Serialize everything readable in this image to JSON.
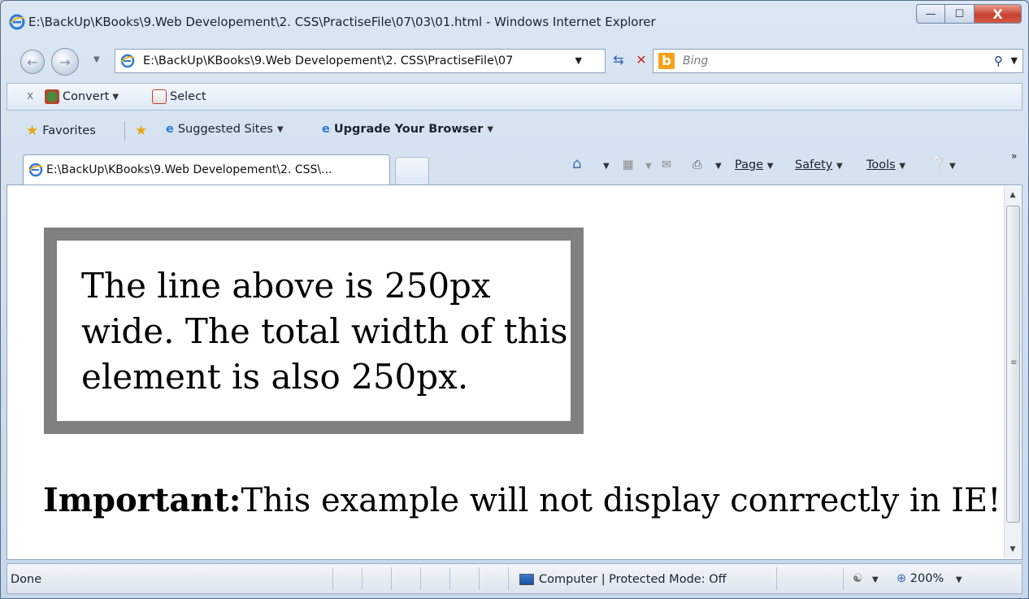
{
  "window": {
    "title": "E:\\BackUp\\KBooks\\9.Web Developement\\2. CSS\\PractiseFile\\07\\03\\01.html - Windows Internet Explorer",
    "minimize": "—",
    "maximize": "☐",
    "close": "X"
  },
  "nav": {
    "address": "E:\\BackUp\\KBooks\\9.Web Developement\\2. CSS\\PractiseFile\\07",
    "search_placeholder": "Bing"
  },
  "command_bar": {
    "close_label": "x",
    "convert_label": "Convert",
    "select_label": "Select"
  },
  "favorites_bar": {
    "favorites_label": "Favorites",
    "suggested_sites_label": "Suggested Sites",
    "upgrade_label": "Upgrade Your Browser"
  },
  "tabs": {
    "active_tab_label": "E:\\BackUp\\KBooks\\9.Web Developement\\2. CSS\\..."
  },
  "toolbar": {
    "page_label": "Page",
    "safety_label": "Safety",
    "tools_label": "Tools",
    "more_label": "»"
  },
  "page": {
    "box_text": "The line above is 250px wide. The total width of this element is also 250px.",
    "important_label": "Important:",
    "important_text": "This example will not display conrrectly in IE!"
  },
  "status": {
    "status_text": "Done",
    "zone_text": "Computer | Protected Mode: Off",
    "zoom_text": "200%"
  },
  "colors": {
    "box_border": "#808080",
    "close_button": "#c8422e",
    "bing": "#f7a11a"
  },
  "icons": [
    "ie-icon",
    "back-icon",
    "forward-icon",
    "refresh-icon",
    "stop-icon",
    "bing-icon",
    "search-icon",
    "convert-icon",
    "select-pdf-icon",
    "favorites-star-icon",
    "add-favorites-icon",
    "home-icon",
    "feeds-icon",
    "mail-icon",
    "print-icon",
    "help-icon",
    "computer-icon",
    "zoom-icon"
  ]
}
